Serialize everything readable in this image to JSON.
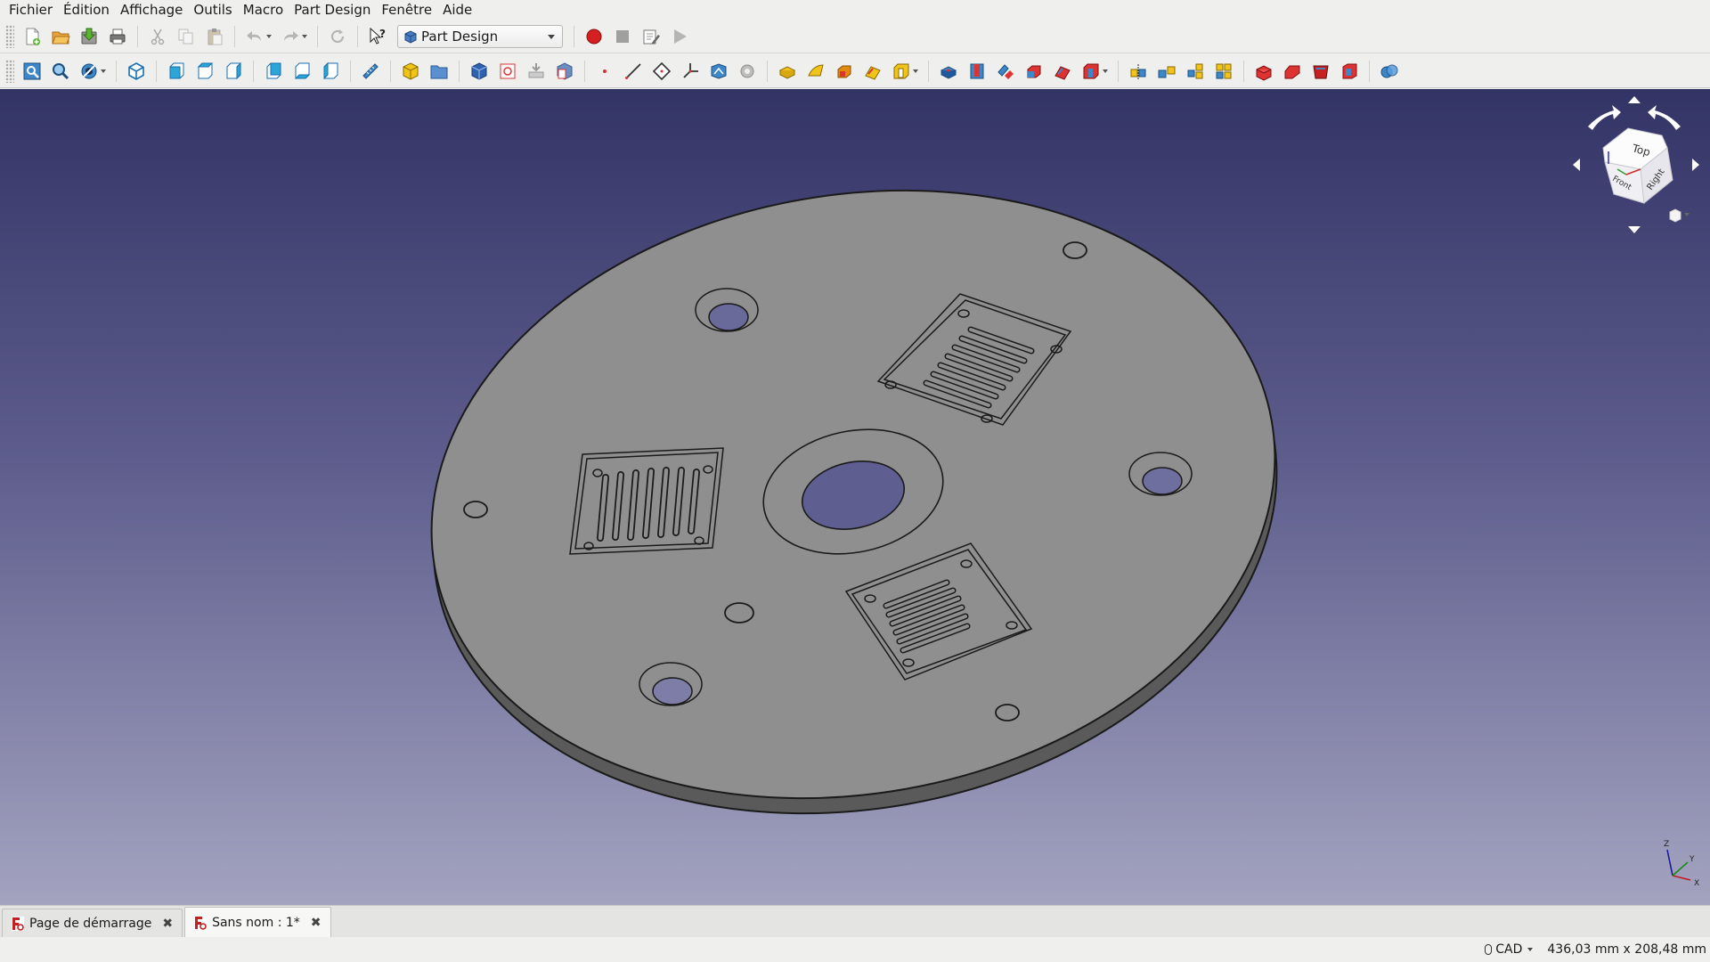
{
  "menu": {
    "items": [
      {
        "label": "Fichier"
      },
      {
        "label": "Édition"
      },
      {
        "label": "Affichage"
      },
      {
        "label": "Outils"
      },
      {
        "label": "Macro"
      },
      {
        "label": "Part Design"
      },
      {
        "label": "Fenêtre"
      },
      {
        "label": "Aide"
      }
    ]
  },
  "toolbar": {
    "workbench_selected": "Part Design"
  },
  "navcube": {
    "faces": {
      "top": "Top",
      "front": "Front",
      "right": "Right"
    }
  },
  "axes": {
    "x": "X",
    "y": "Y",
    "z": "Z"
  },
  "tabs": [
    {
      "label": "Page de démarrage"
    },
    {
      "label": "Sans nom : 1*"
    }
  ],
  "status": {
    "nav_style": "CAD",
    "dimensions": "436,03 mm x 208,48 mm"
  },
  "colors": {
    "viewport_top": "#333466",
    "viewport_bottom": "#a3a3c0",
    "model_face": "#8f8f8f",
    "record_red": "#d42020"
  }
}
